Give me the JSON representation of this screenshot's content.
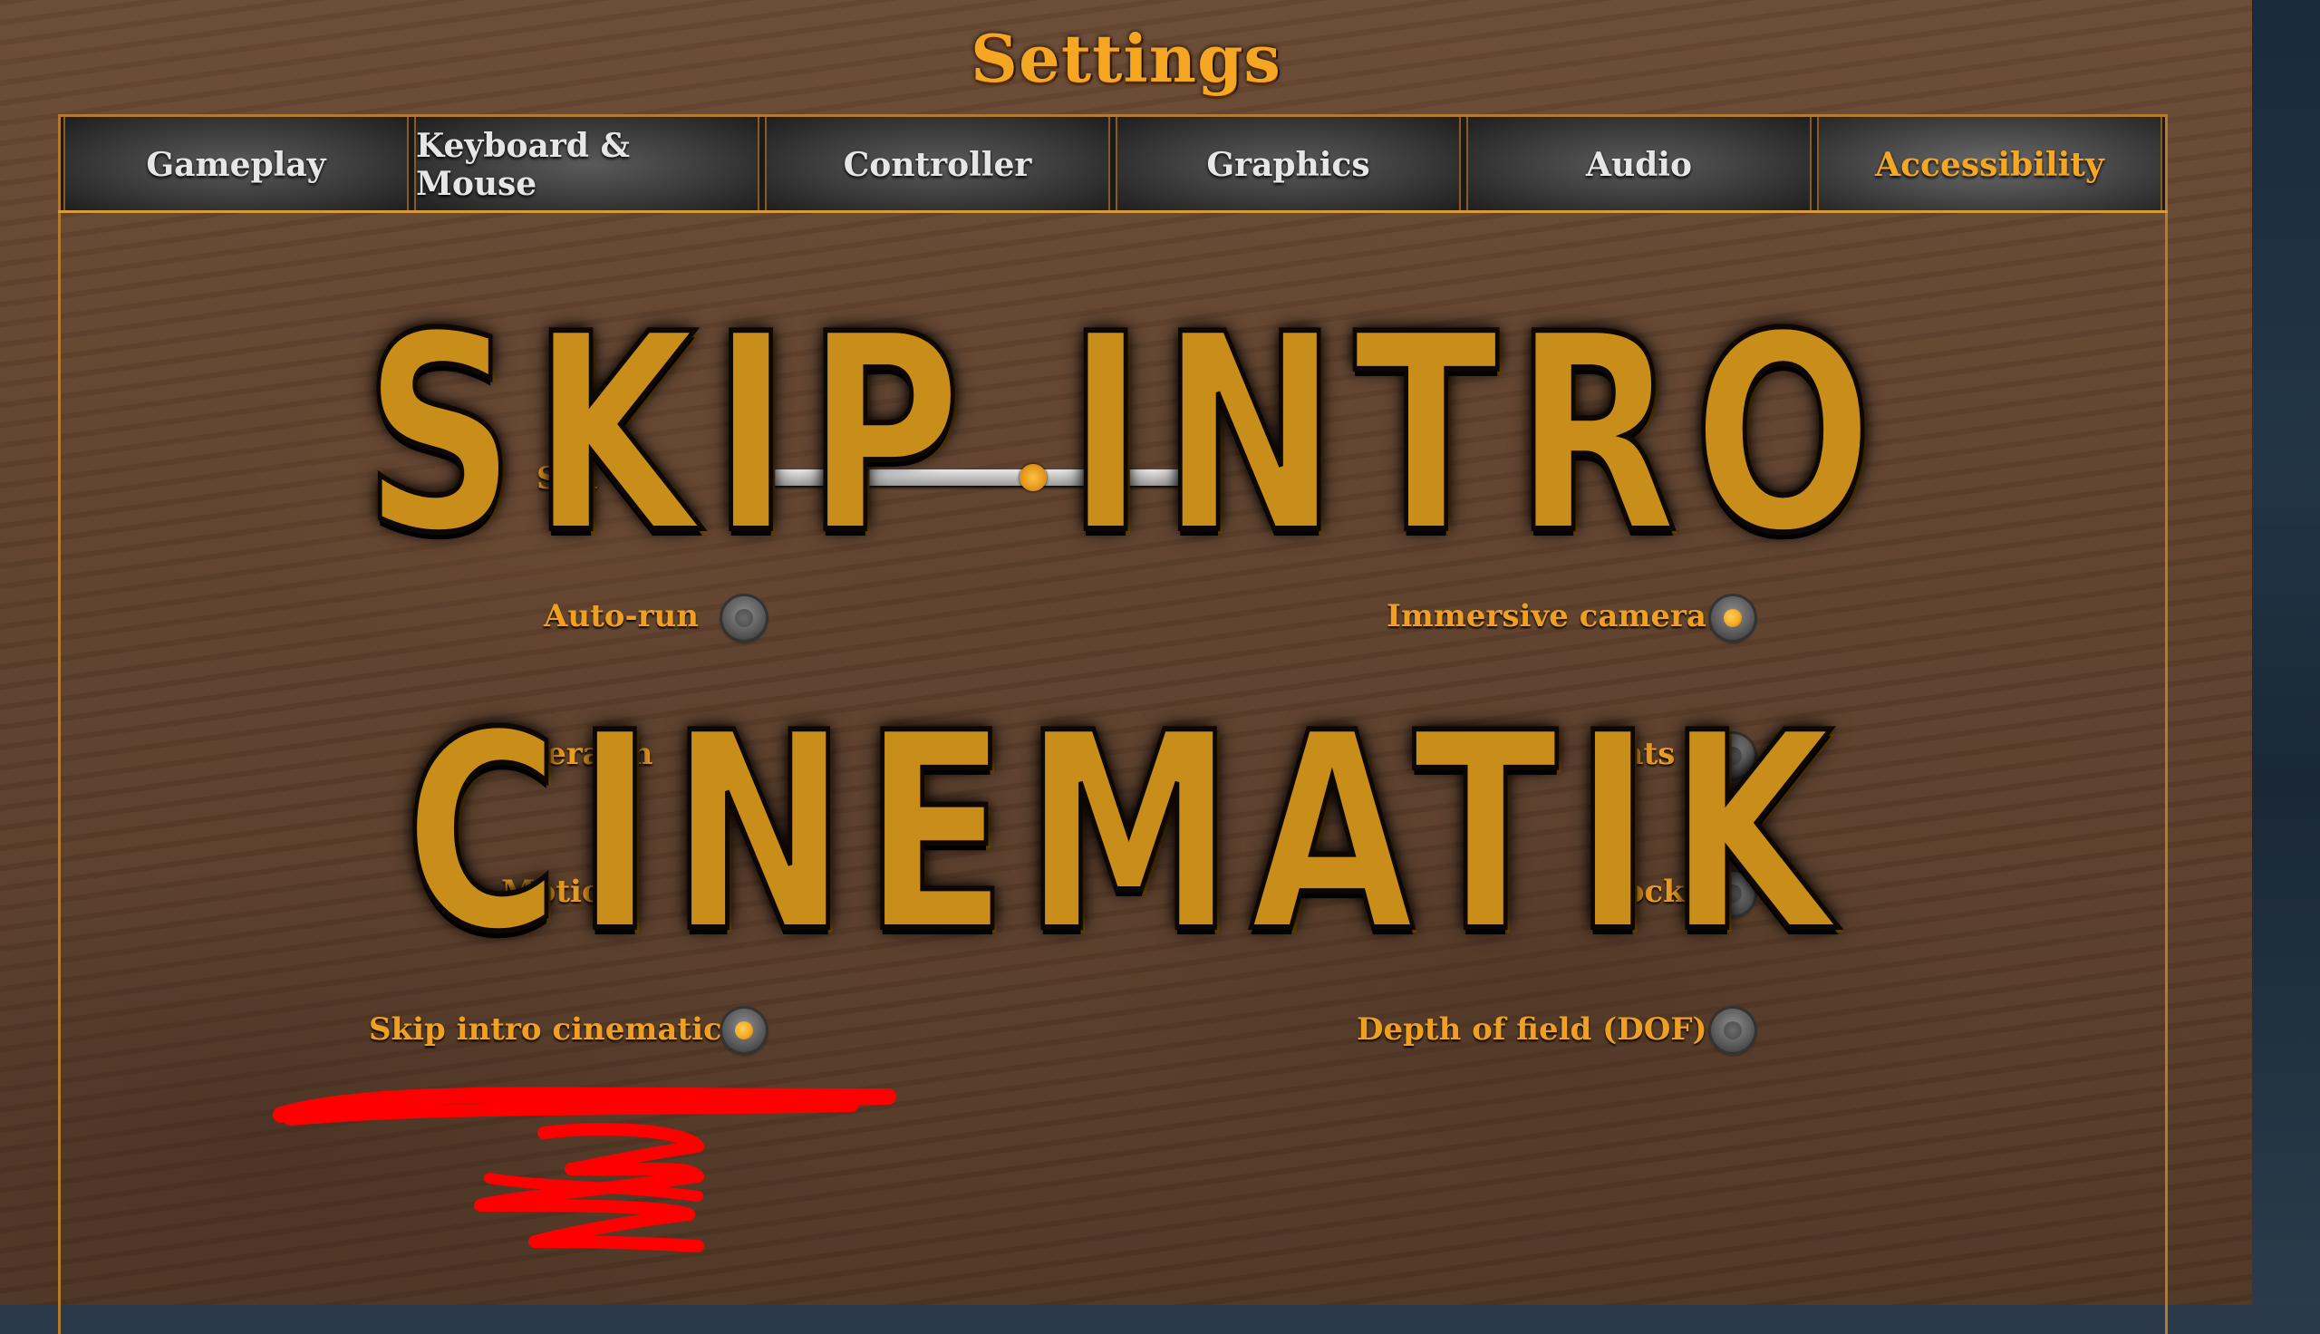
{
  "title": "Settings",
  "tabs": [
    {
      "label": "Gameplay",
      "active": false
    },
    {
      "label": "Keyboard & Mouse",
      "active": false
    },
    {
      "label": "Controller",
      "active": false
    },
    {
      "label": "Graphics",
      "active": false
    },
    {
      "label": "Audio",
      "active": false
    },
    {
      "label": "Accessibility",
      "active": true
    }
  ],
  "slider": {
    "label": "Sca"
  },
  "settings_left": [
    {
      "label": "Auto-run",
      "enabled": false
    },
    {
      "label": "Camera sh",
      "enabled": null
    },
    {
      "label": "Motio",
      "enabled": null
    },
    {
      "label": "Skip intro cinematic",
      "enabled": true
    }
  ],
  "settings_right": [
    {
      "label": "Immersive camera",
      "enabled": true
    },
    {
      "label": "ghts",
      "partial_prefix": "sh",
      "enabled": false
    },
    {
      "label": "block",
      "enabled": false
    },
    {
      "label": "Depth of field (DOF)",
      "enabled": false
    }
  ],
  "overlay": {
    "line1": "SKIP INTRO",
    "line2": "CINEMATIK"
  },
  "colors": {
    "accent": "#f5a623",
    "label": "#f0a020",
    "overlay_text": "#c98e1a",
    "scribble": "#ff0000",
    "wood": "#5f412d"
  }
}
